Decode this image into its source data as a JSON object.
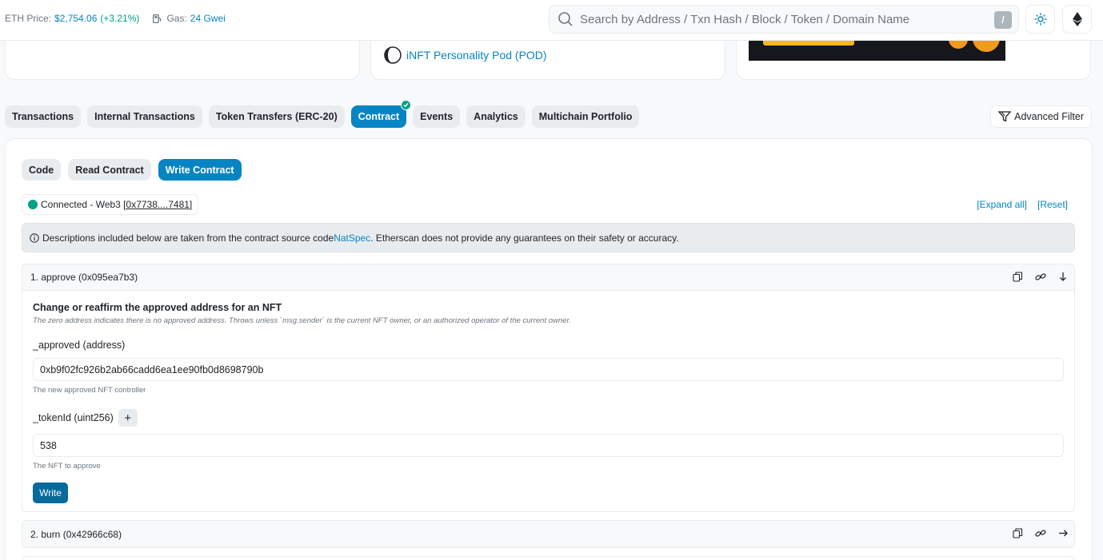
{
  "header": {
    "eth_price_label": "ETH Price:",
    "eth_price_value": "$2,754.06",
    "eth_price_change": "(+3.21%)",
    "gas_label": "Gas:",
    "gas_value": "24 Gwei",
    "search_placeholder": "Search by Address / Txn Hash / Block / Token / Domain Name",
    "search_shortcut": "/"
  },
  "token": {
    "name": "iNFT Personality Pod (POD)"
  },
  "tabs": [
    {
      "label": "Transactions"
    },
    {
      "label": "Internal Transactions"
    },
    {
      "label": "Token Transfers (ERC-20)"
    },
    {
      "label": "Contract"
    },
    {
      "label": "Events"
    },
    {
      "label": "Analytics"
    },
    {
      "label": "Multichain Portfolio"
    }
  ],
  "advanced_filter_label": "Advanced Filter",
  "subtabs": [
    {
      "label": "Code"
    },
    {
      "label": "Read Contract"
    },
    {
      "label": "Write Contract"
    }
  ],
  "connection": {
    "prefix": "Connected - Web3 [",
    "address": "0x7738....7481",
    "suffix": "]"
  },
  "expand_all_label": "[Expand all]",
  "reset_label": "[Reset]",
  "notice": {
    "text_before": "Descriptions included below are taken from the contract source code ",
    "link": "NatSpec",
    "text_after": ". Etherscan does not provide any guarantees on their safety or accuracy."
  },
  "functions": [
    {
      "header": "1. approve (0x095ea7b3)",
      "title": "Change or reaffirm the approved address for an NFT",
      "description": "The zero address indicates there is no approved address. Throws unless `msg.sender` is the current NFT owner, or an authorized operator of the current owner.",
      "params": [
        {
          "label": "_approved (address)",
          "value": "0xb9f02fc926b2ab66cadd6ea1ee90fb0d8698790b",
          "hint": "The new approved NFT controller"
        },
        {
          "label": "_tokenId (uint256)",
          "value": "538",
          "hint": "The NFT to approve",
          "plus": "+"
        }
      ],
      "button": "Write"
    },
    {
      "header": "2. burn (0x42966c68)"
    }
  ]
}
